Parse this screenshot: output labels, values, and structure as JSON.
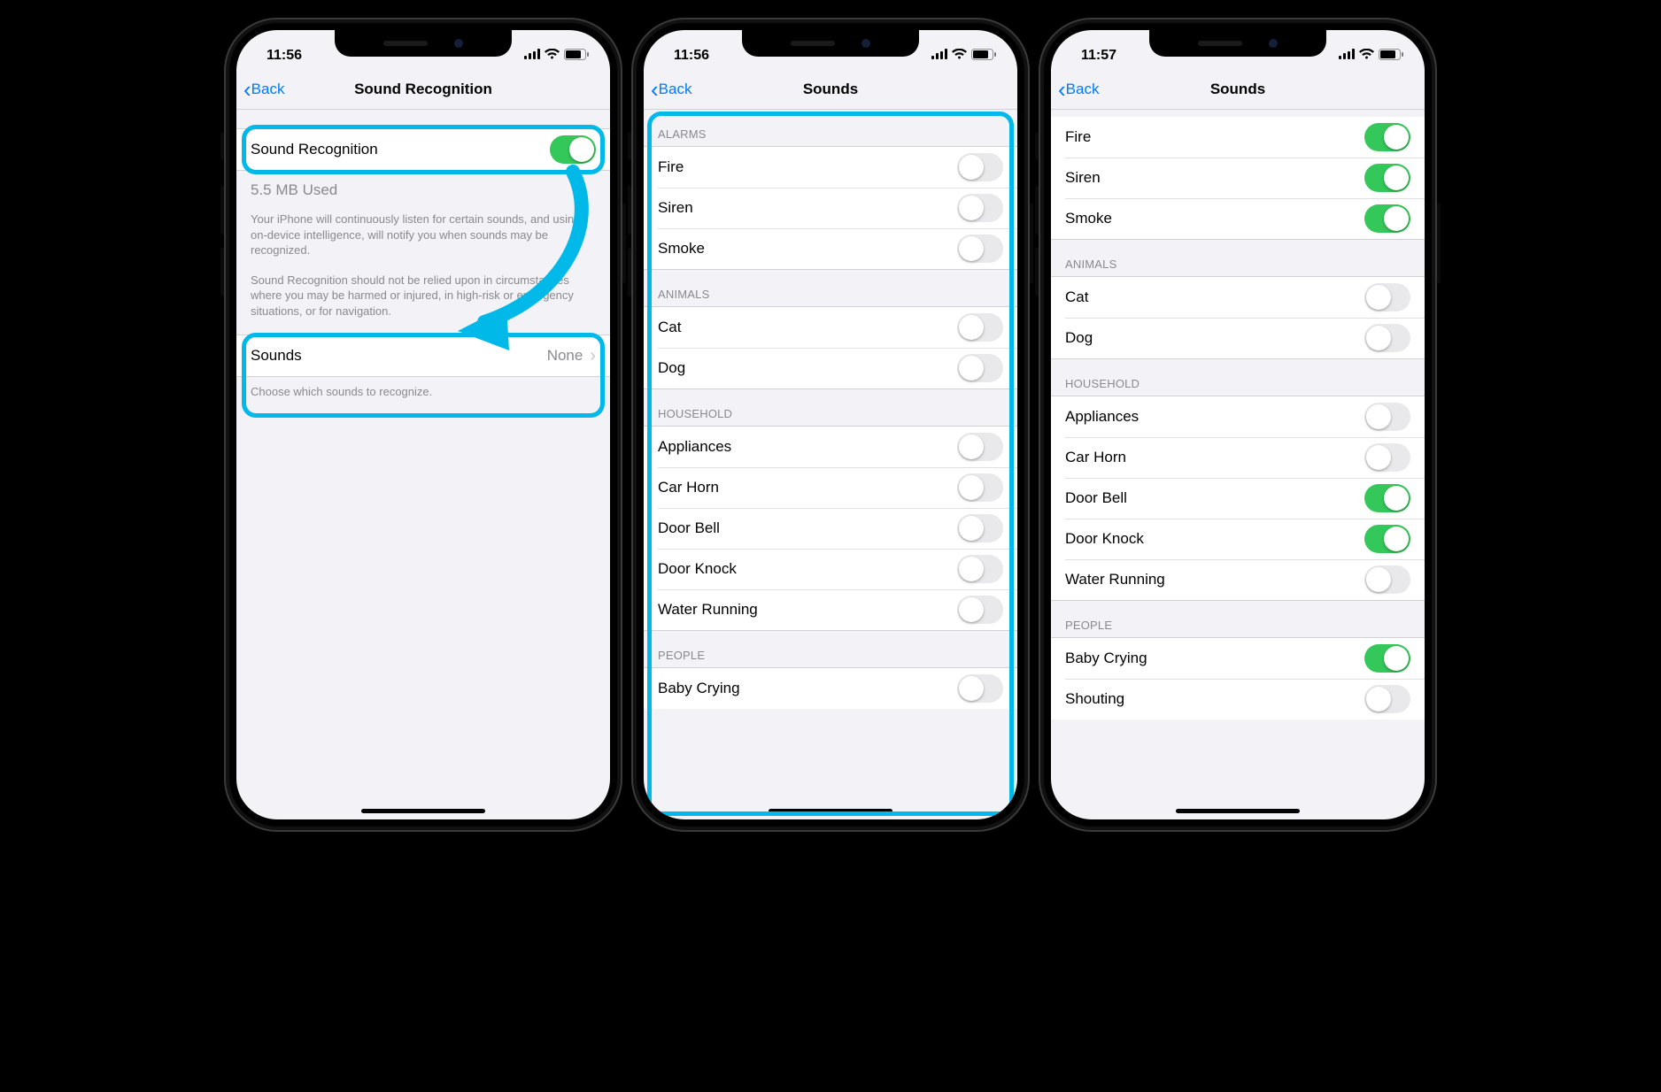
{
  "phone1": {
    "status": {
      "time": "11:56"
    },
    "nav": {
      "back": "Back",
      "title": "Sound Recognition"
    },
    "main": {
      "toggle_label": "Sound Recognition",
      "storage": "5.5 MB Used",
      "desc1": "Your iPhone will continuously listen for certain sounds, and using on-device intelligence, will notify you when sounds may be recognized.",
      "desc2": "Sound Recognition should not be relied upon in circumstances where you may be harmed or injured, in high-risk or emergency situations, or for navigation.",
      "sounds_label": "Sounds",
      "sounds_value": "None",
      "sounds_footer": "Choose which sounds to recognize."
    }
  },
  "phone2": {
    "status": {
      "time": "11:56"
    },
    "nav": {
      "back": "Back",
      "title": "Sounds"
    },
    "sections": {
      "alarms": {
        "header": "ALARMS",
        "items": [
          "Fire",
          "Siren",
          "Smoke"
        ]
      },
      "animals": {
        "header": "ANIMALS",
        "items": [
          "Cat",
          "Dog"
        ]
      },
      "household": {
        "header": "HOUSEHOLD",
        "items": [
          "Appliances",
          "Car Horn",
          "Door Bell",
          "Door Knock",
          "Water Running"
        ]
      },
      "people": {
        "header": "PEOPLE",
        "items": [
          "Baby Crying"
        ]
      }
    }
  },
  "phone3": {
    "status": {
      "time": "11:57"
    },
    "nav": {
      "back": "Back",
      "title": "Sounds"
    },
    "sections": {
      "alarms_partial": {
        "items": [
          {
            "label": "Fire",
            "on": true
          },
          {
            "label": "Siren",
            "on": true
          },
          {
            "label": "Smoke",
            "on": true
          }
        ]
      },
      "animals": {
        "header": "ANIMALS",
        "items": [
          {
            "label": "Cat",
            "on": false
          },
          {
            "label": "Dog",
            "on": false
          }
        ]
      },
      "household": {
        "header": "HOUSEHOLD",
        "items": [
          {
            "label": "Appliances",
            "on": false
          },
          {
            "label": "Car Horn",
            "on": false
          },
          {
            "label": "Door Bell",
            "on": true
          },
          {
            "label": "Door Knock",
            "on": true
          },
          {
            "label": "Water Running",
            "on": false
          }
        ]
      },
      "people": {
        "header": "PEOPLE",
        "items": [
          {
            "label": "Baby Crying",
            "on": true
          },
          {
            "label": "Shouting",
            "on": false
          }
        ]
      }
    }
  }
}
